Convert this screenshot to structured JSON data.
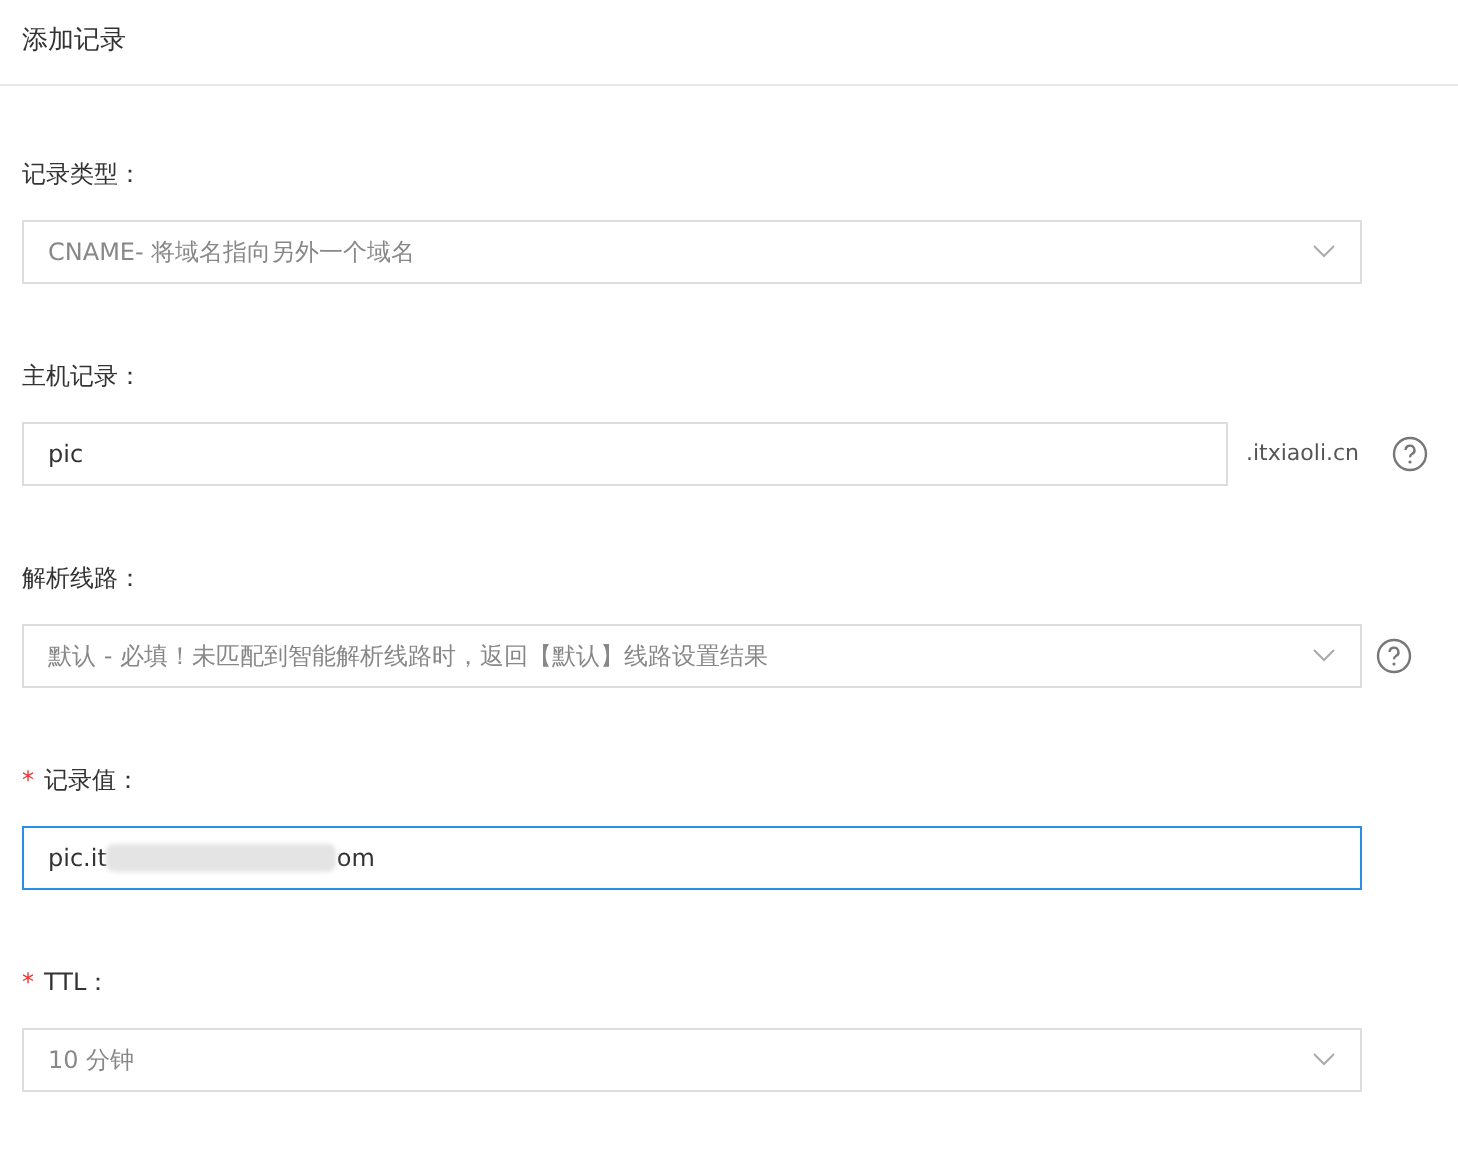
{
  "title": "添加记录",
  "fields": [
    {
      "kind": "select",
      "label": "记录类型：",
      "value": "CNAME- 将域名指向另外一个域名",
      "help": false
    },
    {
      "kind": "input",
      "label": "主机记录：",
      "value": "pic",
      "suffix": ".itxiaoli.cn",
      "help": true,
      "focused": false
    },
    {
      "kind": "select",
      "label": "解析线路：",
      "value": "默认 - 必填！未匹配到智能解析线路时，返回【默认】线路设置结果",
      "help": true
    },
    {
      "kind": "redacted-input",
      "marker": "*",
      "label": "记录值：",
      "value_start": "pic.it",
      "value_end": "om",
      "help": false,
      "focused": true
    },
    {
      "kind": "select",
      "marker": "*",
      "label": "TTL：",
      "value": "10 分钟",
      "help": false
    }
  ]
}
